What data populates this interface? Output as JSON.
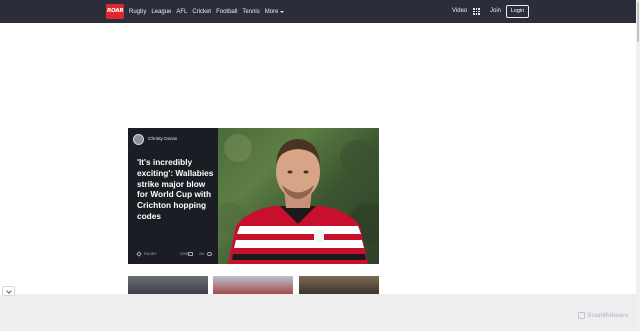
{
  "brand": {
    "logo_text": "ROAR"
  },
  "nav": {
    "items": [
      "Rugby",
      "League",
      "AFL",
      "Cricket",
      "Football",
      "Tennis"
    ],
    "more_label": "More"
  },
  "header_actions": {
    "video_label": "Video",
    "join_label": "Join",
    "login_label": "Login"
  },
  "feature": {
    "author": "Christy Doran",
    "headline": "'It's incredibly exciting': Wallabies strike major blow for World Cup with Crichton hopping codes",
    "tag": "RUGBY",
    "comments": "2098",
    "time_ago": "2hr"
  },
  "watermark": {
    "text": "ScanMalware"
  },
  "colors": {
    "nav_bg": "#2b2e3a",
    "brand_red": "#e0262d",
    "feature_bg": "#1b1d24",
    "jersey_red": "#c8102e"
  }
}
